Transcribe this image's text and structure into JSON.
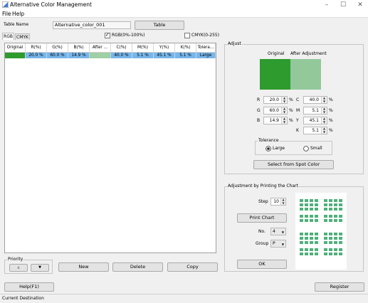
{
  "window": {
    "title": "Alternative Color Management",
    "minimize_glyph": "–",
    "maximize_glyph": "☐",
    "close_glyph": "✕"
  },
  "menu": {
    "file": "File",
    "help": "Help"
  },
  "table_name": {
    "label": "Table Name",
    "value": "Alternative_color_001",
    "button": "Table"
  },
  "tabs": {
    "rgb": "RGB",
    "cmyk": "CMYK"
  },
  "checkboxes": {
    "rgb_label": "RGB(0%-100%)",
    "rgb_checked": "✓",
    "cmyk_label": "CMYK(0-255)"
  },
  "table": {
    "headers": [
      "Original",
      "R(%)",
      "G(%)",
      "B(%)",
      "After ...",
      "C(%)",
      "M(%)",
      "Y(%)",
      "K(%)",
      "Tolera..."
    ],
    "row": {
      "original_color": "#2e9b2e",
      "r": "20.0 %",
      "g": "60.0 %",
      "b": "14.9 %",
      "after_color": "#9fcfa5",
      "c": "40.0 %",
      "m": "5.1 %",
      "y": "45.1 %",
      "k": "5.1 %",
      "tolerance": "Large"
    }
  },
  "priority": {
    "label": "Priority",
    "up_glyph": "▲",
    "down_glyph": "▼"
  },
  "actions": {
    "new": "New",
    "delete": "Delete",
    "copy": "Copy"
  },
  "adjust": {
    "label": "Adjust",
    "original_label": "Original",
    "after_label": "After Adjustment",
    "original_color": "#2e9b2e",
    "after_color": "#93c89b",
    "r_label": "R",
    "r_value": "20.0",
    "g_label": "G",
    "g_value": "60.0",
    "b_label": "B",
    "b_value": "14.9",
    "c_label": "C",
    "c_value": "40.0",
    "m_label": "M",
    "m_value": "5.1",
    "y_label": "Y",
    "y_value": "45.1",
    "k_label": "K",
    "k_value": "5.1",
    "unit": "%",
    "tolerance_label": "Tolerance",
    "tolerance_large": "Large",
    "tolerance_small": "Small",
    "select_spot_button": "Select from Spot Color",
    "spin_up": "▲",
    "spin_down": "▼"
  },
  "print_chart": {
    "label": "Adjustment by Printing the Chart",
    "step_label": "Step",
    "step_value": "10",
    "print_button": "Print Chart",
    "no_label": "No.",
    "no_value": "4",
    "group_label": "Group",
    "group_value": "P",
    "dropdown_glyph": "▼",
    "ok_button": "OK",
    "chart_color": "#4fb07a"
  },
  "bottom": {
    "help": "Help(F1)",
    "register": "Register"
  },
  "status": {
    "label": "Current Destination"
  }
}
